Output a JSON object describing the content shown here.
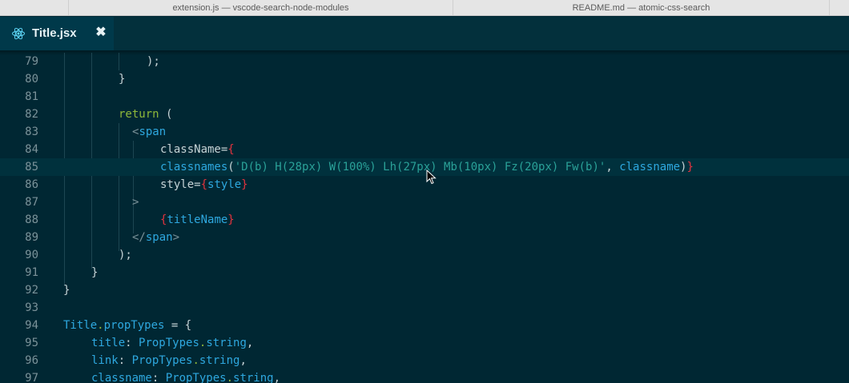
{
  "window_tabs": [
    {
      "label": "extension.js — vscode-search-node-modules"
    },
    {
      "label": "README.md — atomic-css-search"
    }
  ],
  "editor_tab": {
    "label": "Title.jsx",
    "close": "✖",
    "icon": "react-icon"
  },
  "colors": {
    "background": "#002733",
    "keyword": "#8fb83a",
    "function": "#2ea8df",
    "string": "#2aa198",
    "brace": "#e2333e"
  },
  "code": {
    "lines": [
      {
        "n": "79",
        "t": ");"
      },
      {
        "n": "80",
        "t": "}"
      },
      {
        "n": "81",
        "t": ""
      },
      {
        "n": "82",
        "t": "return ("
      },
      {
        "n": "83",
        "t": "<span"
      },
      {
        "n": "84",
        "t": "className={"
      },
      {
        "n": "85",
        "t": "classnames('D(b) H(28px) W(100%) Lh(27px) Mb(10px) Fz(20px) Fw(b)', classname)}"
      },
      {
        "n": "86",
        "t": "style={style}"
      },
      {
        "n": "87",
        "t": ">"
      },
      {
        "n": "88",
        "t": "{titleName}"
      },
      {
        "n": "89",
        "t": "</span>"
      },
      {
        "n": "90",
        "t": ");"
      },
      {
        "n": "91",
        "t": "}"
      },
      {
        "n": "92",
        "t": "}"
      },
      {
        "n": "93",
        "t": ""
      },
      {
        "n": "94",
        "t": "Title.propTypes = {"
      },
      {
        "n": "95",
        "t": "title: PropTypes.string,"
      },
      {
        "n": "96",
        "t": "link: PropTypes.string,"
      },
      {
        "n": "97",
        "t": "classname: PropTypes.string,"
      }
    ]
  },
  "tokens": {
    "l79": ");",
    "l80": "}",
    "l82_kw": "return",
    "l82_p": " (",
    "l83_lt": "<",
    "l83_tag": "span",
    "l84_attr": "className=",
    "l84_br": "{",
    "l85_fn": "classnames",
    "l85_p1": "(",
    "l85_str": "'D(b) H(28px) W(100%) Lh(27px) Mb(10px) Fz(20px) Fw(b)'",
    "l85_comma": ", ",
    "l85_var": "classname",
    "l85_p2": ")",
    "l85_br": "}",
    "l86_attr": "style=",
    "l86_br1": "{",
    "l86_var": "style",
    "l86_br2": "}",
    "l87": ">",
    "l88_br1": "{",
    "l88_var": "titleName",
    "l88_br2": "}",
    "l89_lt": "</",
    "l89_tag": "span",
    "l89_gt": ">",
    "l90": ");",
    "l91": "}",
    "l92": "}",
    "l94_obj": "Title",
    "l94_dot": ".",
    "l94_prop": "propTypes",
    "l94_rest": " = {",
    "l95_key": "title",
    "l95_colon": ": ",
    "l95_obj": "PropTypes",
    "l95_dot": ".",
    "l95_prop": "string",
    "l95_end": ",",
    "l96_key": "link",
    "l96_colon": ": ",
    "l96_obj": "PropTypes",
    "l96_dot": ".",
    "l96_prop": "string",
    "l96_end": ",",
    "l97_key": "classname",
    "l97_colon": ": ",
    "l97_obj": "PropTypes",
    "l97_dot": ".",
    "l97_prop": "string",
    "l97_end": ","
  }
}
